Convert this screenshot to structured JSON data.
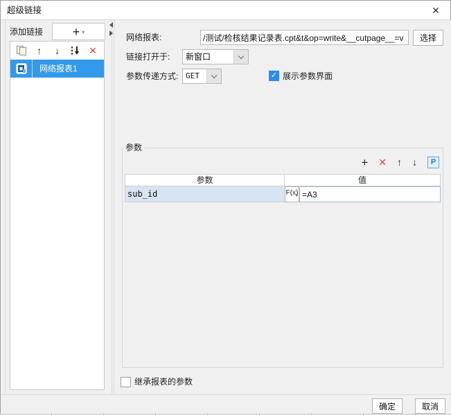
{
  "dialog": {
    "title": "超级链接"
  },
  "icons": {
    "close": "✕",
    "plus": "+",
    "caret_down": "▾",
    "arrow_up": "↑",
    "arrow_down": "↓",
    "delete": "✕",
    "check": "✓",
    "p_toggle": "P",
    "fx": "F(x)"
  },
  "left_panel": {
    "add_label": "添加链接",
    "items": [
      {
        "label": "网络报表1"
      }
    ]
  },
  "form": {
    "report_label": "网络报表:",
    "report_value": "/测试/检核结果记录表.cpt&t&op=write&__cutpage__=v",
    "choose_button": "选择",
    "open_label": "链接打开于:",
    "open_value": "新窗口",
    "method_label": "参数传递方式:",
    "method_value": "GET",
    "show_params_label": "展示参数界面",
    "show_params_checked": true
  },
  "params": {
    "group_title": "参数",
    "table": {
      "param_header": "参数",
      "value_header": "值",
      "rows": [
        {
          "param": "sub_id",
          "value": "=A3"
        }
      ]
    },
    "inherit_label": "继承报表的参数",
    "inherit_checked": false
  },
  "footer": {
    "ok": "确定",
    "cancel": "取消"
  },
  "colors": {
    "selection_blue": "#3399ea",
    "checkbox_blue": "#2d8ceb",
    "delete_red": "#e0423c",
    "p_toggle_border": "#63a8dd",
    "row_param_bg": "#d7e5f2"
  }
}
